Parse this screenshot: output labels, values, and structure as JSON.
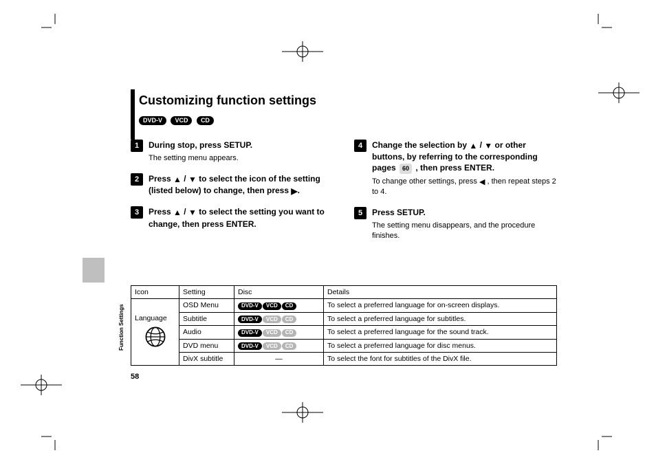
{
  "section_title": "Customizing function settings",
  "top_badges": [
    "DVD-V",
    "VCD",
    "CD"
  ],
  "steps": [
    {
      "num": "1",
      "head_pre": "During stop, press SETUP.",
      "desc": "The setting menu appears."
    },
    {
      "num": "2",
      "head_pre": "Press ",
      "head_mid": " / ",
      "head_post": " to select the icon of the setting (listed below) to change, then press ",
      "head_end": "."
    },
    {
      "num": "3",
      "head_pre": "Press ",
      "head_mid": " / ",
      "head_post": " to select the setting you want to change, then press ENTER."
    },
    {
      "num": "4",
      "head_pre": "Change the selection by ",
      "head_mid": " / ",
      "head_post": " or other buttons, by referring to the corresponding pages ",
      "page_ref": "60",
      "head_tail": " , then press ENTER.",
      "desc_pre": "To change other settings, press ",
      "desc_post": " , then repeat steps 2 to 4."
    },
    {
      "num": "5",
      "head_pre": "Press SETUP.",
      "desc": "The setting menu disappears, and the procedure finishes."
    }
  ],
  "table": {
    "headers": [
      "Icon",
      "Setting",
      "Disc",
      "Details"
    ],
    "icon_label": "Language",
    "rows": [
      {
        "setting": "OSD Menu",
        "discs": [
          [
            "DVD-V",
            false
          ],
          [
            "VCD",
            false
          ],
          [
            "CD",
            false
          ]
        ],
        "details": "To select a preferred language for on-screen displays."
      },
      {
        "setting": "Subtitle",
        "discs": [
          [
            "DVD-V",
            false
          ],
          [
            "VCD",
            true
          ],
          [
            "CD",
            true
          ]
        ],
        "details": "To select a preferred language for subtitles."
      },
      {
        "setting": "Audio",
        "discs": [
          [
            "DVD-V",
            false
          ],
          [
            "VCD",
            true
          ],
          [
            "CD",
            true
          ]
        ],
        "details": "To select a preferred language for the sound track."
      },
      {
        "setting": "DVD menu",
        "discs": [
          [
            "DVD-V",
            false
          ],
          [
            "VCD",
            true
          ],
          [
            "CD",
            true
          ]
        ],
        "details": "To select a preferred language for disc menus."
      },
      {
        "setting": "DivX subtitle",
        "discs": null,
        "dash": "—",
        "details": "To select the font for subtitles of the DivX file."
      }
    ]
  },
  "sidebar_text": "Function Settings",
  "page_number": "58"
}
